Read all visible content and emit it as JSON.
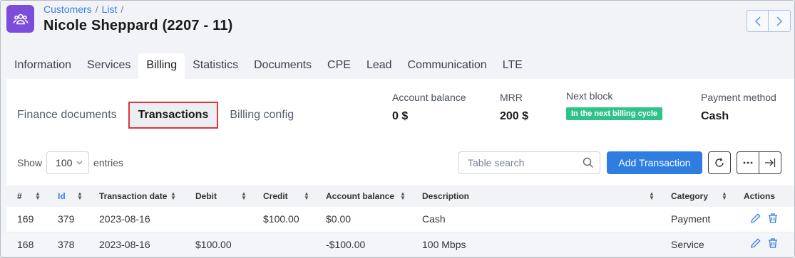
{
  "breadcrumb": {
    "customers": "Customers",
    "list": "List"
  },
  "page": {
    "title": "Nicole Sheppard (2207 - 11)"
  },
  "tabs": [
    "Information",
    "Services",
    "Billing",
    "Statistics",
    "Documents",
    "CPE",
    "Lead",
    "Communication",
    "LTE"
  ],
  "active_tab": "Billing",
  "subtabs": [
    "Finance documents",
    "Transactions",
    "Billing config"
  ],
  "active_subtab": "Transactions",
  "summary": {
    "account_balance_label": "Account balance",
    "account_balance_value": "0 $",
    "mrr_label": "MRR",
    "mrr_value": "200 $",
    "next_block_label": "Next block",
    "next_block_value": "In the next billing cycle",
    "payment_method_label": "Payment method",
    "payment_method_value": "Cash"
  },
  "toolbar": {
    "show_label": "Show",
    "page_size": "100",
    "entries_label": "entries",
    "search_placeholder": "Table search",
    "add_button": "Add Transaction"
  },
  "table": {
    "headers": [
      "#",
      "Id",
      "Transaction date",
      "Debit",
      "Credit",
      "Account balance",
      "Description",
      "Category",
      "Actions"
    ],
    "rows": [
      {
        "num": "169",
        "id": "379",
        "date": "2023-08-16",
        "debit": "",
        "credit": "$100.00",
        "balance": "$0.00",
        "description": "Cash",
        "category": "Payment"
      },
      {
        "num": "168",
        "id": "378",
        "date": "2023-08-16",
        "debit": "$100.00",
        "credit": "",
        "balance": "-$100.00",
        "description": "100 Mbps",
        "category": "Service"
      }
    ]
  },
  "colors": {
    "accent": "#2f7de1",
    "brand": "#7c4ddb",
    "badge": "#2fc38a",
    "highlight": "#d9363e"
  }
}
